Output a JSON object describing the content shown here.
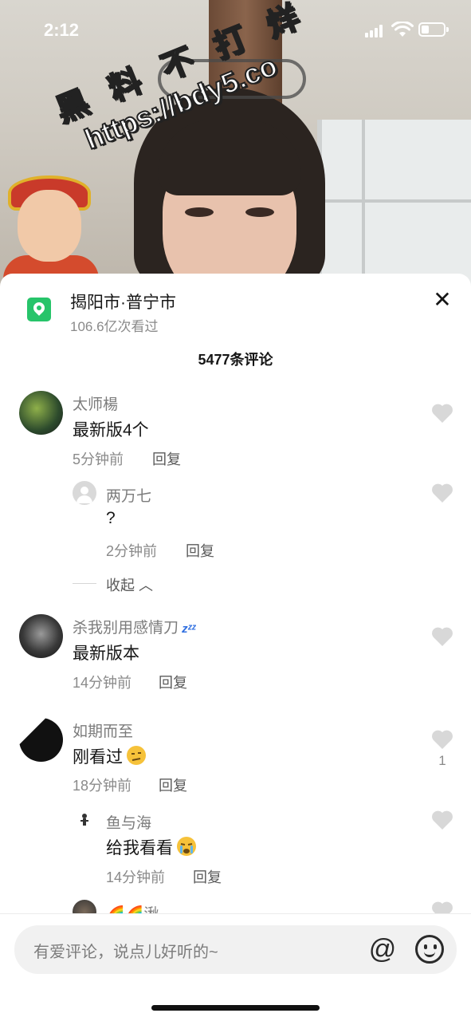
{
  "status_bar": {
    "time": "2:12"
  },
  "watermark": {
    "line1": "黑 料 不 打 烊",
    "line2": "https://bdy5.co"
  },
  "location": {
    "title": "揭阳市·普宁市",
    "views": "106.6亿次看过"
  },
  "comments_header": {
    "count": "5477条评论"
  },
  "comments": [
    {
      "user": "太师楊",
      "text": "最新版4个",
      "time": "5分钟前",
      "reply": "回复"
    },
    {
      "user": "两万七",
      "text": "?",
      "time": "2分钟前",
      "reply": "回复"
    },
    {
      "user": "杀我别用感情刀",
      "text": "最新版本",
      "time": "14分钟前",
      "reply": "回复"
    },
    {
      "user": "如期而至",
      "text": "刚看过",
      "time": "18分钟前",
      "reply": "回复",
      "likes": "1"
    },
    {
      "user": "鱼与海",
      "text": "给我看看",
      "time": "14分钟前",
      "reply": "回复"
    },
    {
      "user": "🌈🌈湫"
    }
  ],
  "collapse_label": "收起",
  "input": {
    "placeholder": "有爱评论，说点儿好听的~"
  },
  "icons": {
    "location": "location-pin-icon",
    "close": "close-icon",
    "like": "heart-icon",
    "mention": "at-icon",
    "emoji": "emoji-icon",
    "zzz": "zzz-icon"
  },
  "colors": {
    "accent_green": "#27c46a",
    "heart_gray": "#d8d8d8",
    "text_primary": "#161616",
    "text_secondary": "#8a8a8a"
  }
}
